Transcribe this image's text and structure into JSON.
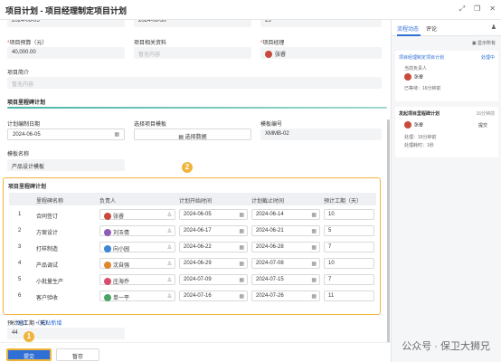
{
  "window": {
    "title": "项目计划 - 项目经理制定项目计划",
    "icons": [
      "expand-icon",
      "restore-icon",
      "close-icon"
    ]
  },
  "form": {
    "row0": {
      "start": "2024-06-05",
      "end": "2024-06-30",
      "count": "25"
    },
    "budget_label": "项目预算（元）",
    "budget_value": "40,000.00",
    "materials_label": "项目相关资料",
    "materials_placeholder": "暂无内容",
    "manager_label": "项目经理",
    "manager_value": "张睿",
    "intro_label": "项目简介",
    "intro_placeholder": "暂无内容",
    "milestone_section": "项目里程碑计划",
    "plan_date_label": "计划编制日期",
    "plan_date_value": "2024-06-05",
    "template_label": "选择项目模板",
    "template_button": "选择数据",
    "template_code_label": "模板编号",
    "template_code_value": "XMMB-02",
    "template_name_label": "模板名称",
    "template_name_value": "产品设计模板"
  },
  "table": {
    "title": "项目里程碑计划",
    "headers": [
      "",
      "里程碑名称",
      "负责人",
      "计划开始时间",
      "计划截止时间",
      "预计工期（天）"
    ],
    "rows": [
      {
        "no": "1",
        "name": "合同签订",
        "owner": "张睿",
        "color": "#c94a3c",
        "start": "2024-06-05",
        "end": "2024-06-14",
        "days": "10"
      },
      {
        "no": "2",
        "name": "方案设计",
        "owner": "刘玉倩",
        "color": "#8e5bb5",
        "start": "2024-06-17",
        "end": "2024-06-21",
        "days": "5"
      },
      {
        "no": "3",
        "name": "打样制造",
        "owner": "向小园",
        "color": "#3d86d9",
        "start": "2024-06-22",
        "end": "2024-06-28",
        "days": "7"
      },
      {
        "no": "4",
        "name": "产品调试",
        "owner": "沈自强",
        "color": "#e0872d",
        "start": "2024-06-29",
        "end": "2024-07-08",
        "days": "10"
      },
      {
        "no": "5",
        "name": "小批量生产",
        "owner": "庄海乔",
        "color": "#d84c6c",
        "start": "2024-07-09",
        "end": "2024-07-15",
        "days": "7"
      },
      {
        "no": "6",
        "name": "客户验收",
        "owner": "单一平",
        "color": "#4aa565",
        "start": "2024-07-16",
        "end": "2024-07-26",
        "days": "11"
      }
    ],
    "add_label": "+ 添加",
    "paste_label": "+ 粘贴新增"
  },
  "total": {
    "label": "预计总工期（天）",
    "value": "44"
  },
  "footer": {
    "submit": "提交",
    "save": "暂存"
  },
  "badges": {
    "one": "1",
    "two": "2"
  },
  "side": {
    "tab_flow": "流程动态",
    "tab_comment": "评论",
    "show_all": "显示所有",
    "card1": {
      "title": "项目经理制定项目计划",
      "status": "处理中",
      "line1": "当前负责人",
      "person": "张睿",
      "line2": "已等待：16分钟前"
    },
    "card2": {
      "title": "发起项目里程碑计划",
      "time": "16分钟前",
      "person": "张睿",
      "action": "提交",
      "line1": "处理：16分钟前",
      "line2": "处理耗时：1秒"
    }
  },
  "watermark": "公众号 · 保卫大狮兄"
}
